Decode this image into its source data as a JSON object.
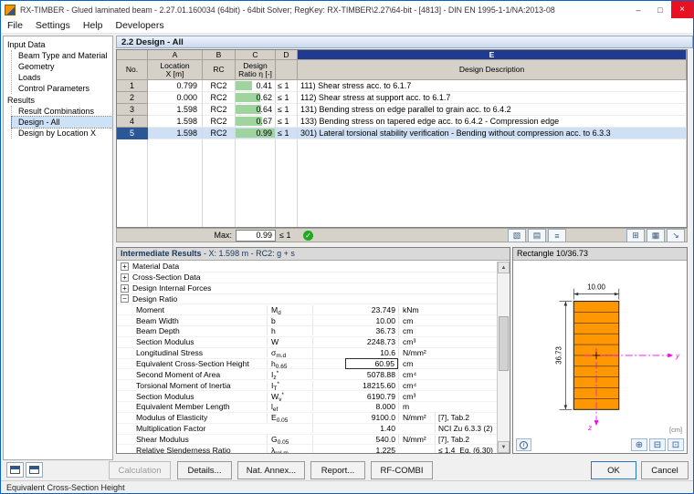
{
  "window": {
    "title": "RX-TIMBER - Glued laminated beam - 2.27.01.160034 (64bit) - 64bit Solver; RegKey: RX-TIMBER\\2.27\\64-bit - [4813] - DIN EN 1995-1-1/NA:2013-08",
    "menus": [
      "File",
      "Settings",
      "Help",
      "Developers"
    ],
    "controls": {
      "minimize": "–",
      "maximize": "□",
      "close": "×"
    }
  },
  "navigator": {
    "sections": [
      {
        "label": "Input Data",
        "items": [
          {
            "label": "Beam Type and Material"
          },
          {
            "label": "Geometry"
          },
          {
            "label": "Loads"
          },
          {
            "label": "Control Parameters"
          }
        ]
      },
      {
        "label": "Results",
        "items": [
          {
            "label": "Result Combinations"
          },
          {
            "label": "Design - All",
            "selected": true
          },
          {
            "label": "Design by Location X"
          }
        ]
      }
    ]
  },
  "panel": {
    "title": "2.2 Design - All",
    "table": {
      "col_letters": [
        "A",
        "B",
        "C",
        "D",
        "E"
      ],
      "headers": {
        "no": "No.",
        "location": "Location",
        "x_unit": "X [m]",
        "rc": "RC",
        "design": "Design",
        "ratio": "Ratio η [-]",
        "desc": "Design Description"
      },
      "rows": [
        {
          "no": "1",
          "x": "0.799",
          "rc": "RC2",
          "ratio": 0.41,
          "ratio_text": "0.41",
          "lim": "≤ 1",
          "desc": "111) Shear stress acc. to 6.1.7",
          "selected": false
        },
        {
          "no": "2",
          "x": "0.000",
          "rc": "RC2",
          "ratio": 0.62,
          "ratio_text": "0.62",
          "lim": "≤ 1",
          "desc": "112) Shear stress at support acc. to 6.1.7",
          "selected": false
        },
        {
          "no": "3",
          "x": "1.598",
          "rc": "RC2",
          "ratio": 0.64,
          "ratio_text": "0.64",
          "lim": "≤ 1",
          "desc": "131) Bending stress on edge parallel to grain acc. to 6.4.2",
          "selected": false
        },
        {
          "no": "4",
          "x": "1.598",
          "rc": "RC2",
          "ratio": 0.67,
          "ratio_text": "0.67",
          "lim": "≤ 1",
          "desc": "133) Bending stress on tapered edge acc. to 6.4.2 - Compression edge",
          "selected": false
        },
        {
          "no": "5",
          "x": "1.598",
          "rc": "RC2",
          "ratio": 0.99,
          "ratio_text": "0.99",
          "lim": "≤ 1",
          "desc": "301) Lateral torsional stability verification - Bending without compression acc. to 6.3.3",
          "selected": true
        }
      ],
      "max_label": "Max:",
      "max_value": "0.99",
      "max_lim": "≤ 1"
    },
    "toolbar_left": [
      {
        "name": "result-colors-icon",
        "glyph": "▧"
      },
      {
        "name": "filter-rows-icon",
        "glyph": "▤"
      },
      {
        "name": "table-settings-icon",
        "glyph": "≡"
      }
    ],
    "toolbar_right": [
      {
        "name": "print-icon",
        "glyph": "⊞"
      },
      {
        "name": "excel-export-icon",
        "glyph": "▦"
      },
      {
        "name": "export-icon",
        "glyph": "↘"
      }
    ]
  },
  "intermediate": {
    "title": "Intermediate Results",
    "context": "-  X: 1.598 m  -  RC2: g + s",
    "groups": [
      {
        "label": "Material Data",
        "expanded": false
      },
      {
        "label": "Cross-Section Data",
        "expanded": false
      },
      {
        "label": "Design Internal Forces",
        "expanded": false
      },
      {
        "label": "Design Ratio",
        "expanded": true,
        "rows": [
          {
            "label": "Moment",
            "sym": "M",
            "sub": "d",
            "sup": "",
            "value": "23.749",
            "unit": "kNm",
            "lim": "",
            "note": "",
            "boxed": false
          },
          {
            "label": "Beam Width",
            "sym": "b",
            "sub": "",
            "sup": "",
            "value": "10.00",
            "unit": "cm",
            "lim": "",
            "note": "",
            "boxed": false
          },
          {
            "label": "Beam Depth",
            "sym": "h",
            "sub": "",
            "sup": "",
            "value": "36.73",
            "unit": "cm",
            "lim": "",
            "note": "",
            "boxed": false
          },
          {
            "label": "Section Modulus",
            "sym": "W",
            "sub": "",
            "sup": "",
            "value": "2248.73",
            "unit": "cm³",
            "lim": "",
            "note": "",
            "boxed": false
          },
          {
            "label": "Longitudinal Stress",
            "sym": "σ",
            "sub": "m,d",
            "sup": "",
            "value": "10.6",
            "unit": "N/mm²",
            "lim": "",
            "note": "",
            "boxed": false
          },
          {
            "label": "Equivalent Cross-Section Height",
            "sym": "h",
            "sub": "0,65",
            "sup": "",
            "value": "60.95",
            "unit": "cm",
            "lim": "",
            "note": "",
            "boxed": true
          },
          {
            "label": "Second Moment of Area",
            "sym": "I",
            "sub": "z",
            "sup": "*",
            "value": "5078.88",
            "unit": "cm⁴",
            "lim": "",
            "note": "",
            "boxed": false
          },
          {
            "label": "Torsional Moment of Inertia",
            "sym": "I",
            "sub": "T",
            "sup": "*",
            "value": "18215.60",
            "unit": "cm⁴",
            "lim": "",
            "note": "",
            "boxed": false
          },
          {
            "label": "Section Modulus",
            "sym": "W",
            "sub": "y",
            "sup": "*",
            "value": "6190.79",
            "unit": "cm³",
            "lim": "",
            "note": "",
            "boxed": false
          },
          {
            "label": "Equivalent Member Length",
            "sym": "l",
            "sub": "ef",
            "sup": "",
            "value": "8.000",
            "unit": "m",
            "lim": "",
            "note": "",
            "boxed": false
          },
          {
            "label": "Modulus of Elasticity",
            "sym": "E",
            "sub": "0,05",
            "sup": "",
            "value": "9100.0",
            "unit": "N/mm²",
            "lim": "",
            "note": "[7], Tab.2",
            "boxed": false
          },
          {
            "label": "Multiplication Factor",
            "sym": "",
            "sub": "",
            "sup": "",
            "value": "1.40",
            "unit": "",
            "lim": "",
            "note": "NCI Zu 6.3.3 (2)",
            "boxed": false
          },
          {
            "label": "Shear Modulus",
            "sym": "G",
            "sub": "0,05",
            "sup": "",
            "value": "540.0",
            "unit": "N/mm²",
            "lim": "",
            "note": "[7], Tab.2",
            "boxed": false
          },
          {
            "label": "Relative Slenderness Ratio",
            "sym": "λ",
            "sub": "rel,m",
            "sup": "",
            "value": "1.225",
            "unit": "",
            "lim": "≤ 1.4",
            "note": "Eq. (6.30)",
            "boxed": false
          }
        ]
      }
    ]
  },
  "section": {
    "title": "Rectangle 10/36.73",
    "width_dim": "10.00",
    "height_dim": "36.73",
    "axis_y": "y",
    "axis_z": "z",
    "unit": "[cm]",
    "info": "i",
    "zoom_icons": [
      {
        "name": "zoom-in-icon",
        "glyph": "⊕"
      },
      {
        "name": "zoom-out-icon",
        "glyph": "⊟"
      },
      {
        "name": "zoom-window-icon",
        "glyph": "⊡"
      }
    ]
  },
  "buttons": {
    "calculation": "Calculation",
    "details": "Details...",
    "nat_annex": "Nat. Annex...",
    "report": "Report...",
    "rf_combi": "RF-COMBI",
    "ok": "OK",
    "cancel": "Cancel"
  },
  "statusbar": "Equivalent Cross-Section Height",
  "colors": {
    "selection_row": "#cfe0f5",
    "selection_header": "#2b5797",
    "ratio_bar": "#9fd49f",
    "column_e_header": "#1f3a8f",
    "section_fill": "#ff9800",
    "axis_color": "#ff00ff",
    "check_green": "#1faa1f",
    "close_red": "#e81123"
  }
}
